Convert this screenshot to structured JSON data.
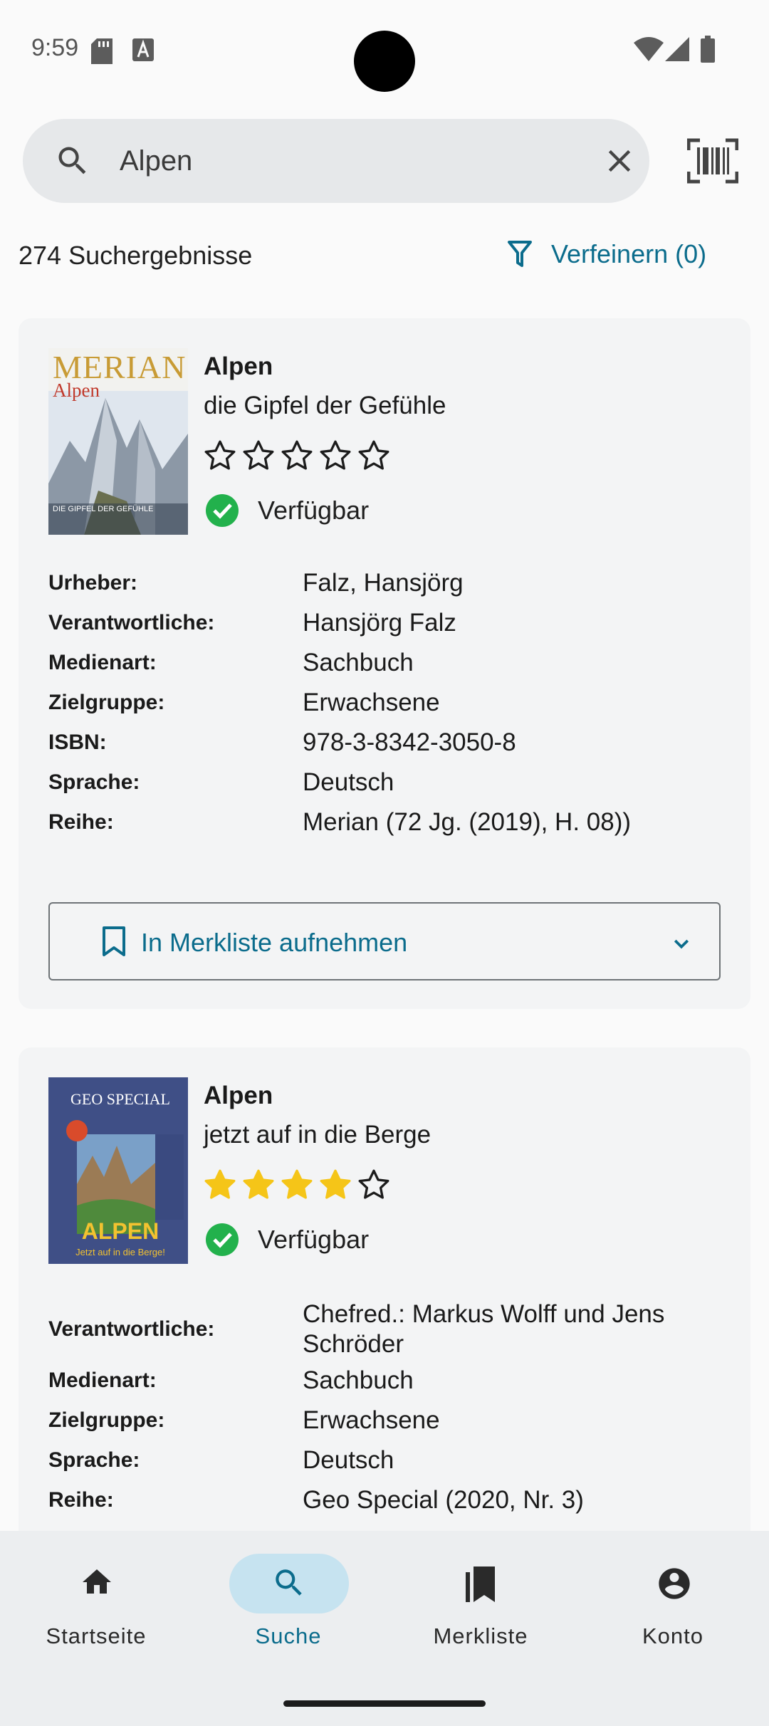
{
  "status_bar": {
    "time": "9:59"
  },
  "search": {
    "value": "Alpen",
    "placeholder": ""
  },
  "results": {
    "count_label": "274 Suchergebnisse",
    "refine_label": "Verfeinern (0)"
  },
  "cards": [
    {
      "cover_text": "MERIAN",
      "cover_subtext": "Alpen",
      "cover_tagline": "DIE GIPFEL DER GEFÜHLE",
      "title": "Alpen",
      "subtitle": "die Gipfel der Gefühle",
      "rating": 0,
      "rating_max": 5,
      "availability": "Verfügbar",
      "details": [
        {
          "label": "Urheber:",
          "value": "Falz, Hansjörg"
        },
        {
          "label": "Verantwortliche:",
          "value": "Hansjörg Falz"
        },
        {
          "label": "Medienart:",
          "value": "Sachbuch"
        },
        {
          "label": "Zielgruppe:",
          "value": "Erwachsene"
        },
        {
          "label": "ISBN:",
          "value": "978-3-8342-3050-8"
        },
        {
          "label": "Sprache:",
          "value": "Deutsch"
        },
        {
          "label": "Reihe:",
          "value": "Merian (72 Jg. (2019), H. 08))"
        }
      ],
      "watchlist_label": "In Merkliste aufnehmen"
    },
    {
      "cover_text": "GEO SPECIAL",
      "cover_subtext": "ALPEN",
      "cover_tagline": "Jetzt auf in die Berge!",
      "title": "Alpen",
      "subtitle": "jetzt auf in die Berge",
      "rating": 4,
      "rating_max": 5,
      "availability": "Verfügbar",
      "details": [
        {
          "label": "Verantwortliche:",
          "value": "Chefred.: Markus Wolff und Jens Schröder"
        },
        {
          "label": "Medienart:",
          "value": "Sachbuch"
        },
        {
          "label": "Zielgruppe:",
          "value": "Erwachsene"
        },
        {
          "label": "Sprache:",
          "value": "Deutsch"
        },
        {
          "label": "Reihe:",
          "value": "Geo Special (2020, Nr. 3)"
        }
      ]
    }
  ],
  "bottom_nav": {
    "items": [
      {
        "label": "Startseite",
        "icon": "home-icon"
      },
      {
        "label": "Suche",
        "icon": "search-icon",
        "active": true
      },
      {
        "label": "Merkliste",
        "icon": "bookmarks-icon"
      },
      {
        "label": "Konto",
        "icon": "account-icon"
      }
    ]
  },
  "colors": {
    "accent": "#0b6c8c",
    "available_green": "#22b14c",
    "star_yellow": "#f5c518",
    "active_pill": "#c6e3f0"
  }
}
